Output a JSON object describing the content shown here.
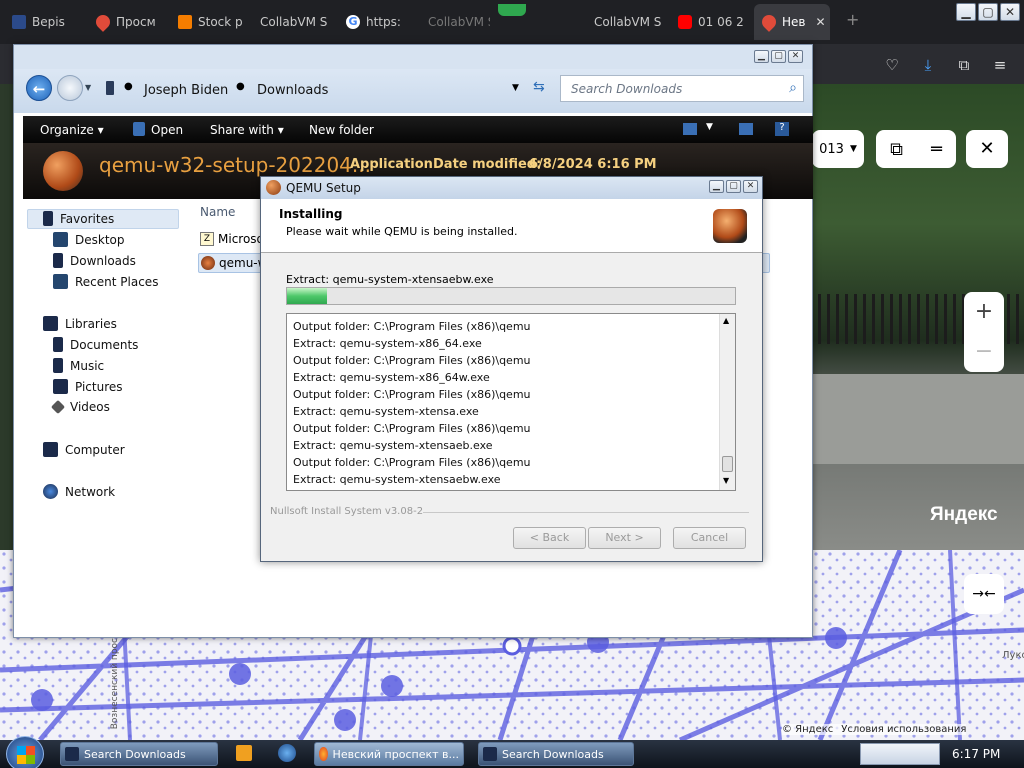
{
  "browser": {
    "tabs": [
      {
        "label": "Bepis |",
        "icon": "page-icon"
      },
      {
        "label": "Просм",
        "icon": "map-pin-icon"
      },
      {
        "label": "Stock p",
        "icon": "blogger-icon"
      },
      {
        "label": "CollabVM S",
        "icon": "page-icon"
      },
      {
        "label": "https:",
        "icon": "google-icon"
      },
      {
        "label": "CollabVM S",
        "icon": "page-icon"
      },
      {
        "label": "01 06 2",
        "icon": "youtube-icon"
      },
      {
        "label": "Нев",
        "icon": "map-pin-icon"
      }
    ],
    "toolbar_icons": [
      "pocket-icon",
      "download-icon",
      "extensions-icon",
      "menu-icon"
    ]
  },
  "map_overlay": {
    "year_selector": "013",
    "brand": "Яндекс",
    "street_label": "Вознесенский прос",
    "side_label": "Луко",
    "copyright": "© Яндекс",
    "terms": "Условия использования",
    "zoom_in": "+",
    "zoom_out": "−"
  },
  "explorer": {
    "breadcrumb": [
      "Joseph Biden",
      "Downloads"
    ],
    "search_placeholder": "Search Downloads",
    "commands": {
      "organize": "Organize",
      "open": "Open",
      "share": "Share with",
      "new_folder": "New folder"
    },
    "details": {
      "file_name": "qemu-w32-setup-202204...",
      "type": "Application",
      "date_label": "Date modified:",
      "date_value": "6/8/2024 6:16 PM"
    },
    "nav": {
      "favorites": "Favorites",
      "desktop": "Desktop",
      "downloads": "Downloads",
      "recent": "Recent Places",
      "libraries": "Libraries",
      "documents": "Documents",
      "music": "Music",
      "pictures": "Pictures",
      "videos": "Videos",
      "computer": "Computer",
      "network": "Network"
    },
    "column_name": "Name",
    "files": [
      "Microso",
      "qemu-w"
    ]
  },
  "qemu": {
    "title": "QEMU Setup",
    "header_title": "Installing",
    "header_sub": "Please wait while QEMU is being installed.",
    "status": "Extract: qemu-system-xtensaebw.exe",
    "progress": 0.09,
    "log": [
      "Output folder: C:\\Program Files (x86)\\qemu",
      "Extract: qemu-system-x86_64.exe",
      "Output folder: C:\\Program Files (x86)\\qemu",
      "Extract: qemu-system-x86_64w.exe",
      "Output folder: C:\\Program Files (x86)\\qemu",
      "Extract: qemu-system-xtensa.exe",
      "Output folder: C:\\Program Files (x86)\\qemu",
      "Extract: qemu-system-xtensaeb.exe",
      "Output folder: C:\\Program Files (x86)\\qemu",
      "Extract: qemu-system-xtensaebw.exe"
    ],
    "branding": "Nullsoft Install System v3.08-2",
    "buttons": {
      "back": "< Back",
      "next": "Next >",
      "cancel": "Cancel"
    }
  },
  "taskbar": {
    "items": [
      "Search Downloads",
      "Невский проспект в...",
      "Search Downloads"
    ],
    "clock": "6:17 PM"
  },
  "colors": {
    "accent": "#3a78c8",
    "progress": "#4ec86a",
    "map_route": "#5b5ee0"
  }
}
